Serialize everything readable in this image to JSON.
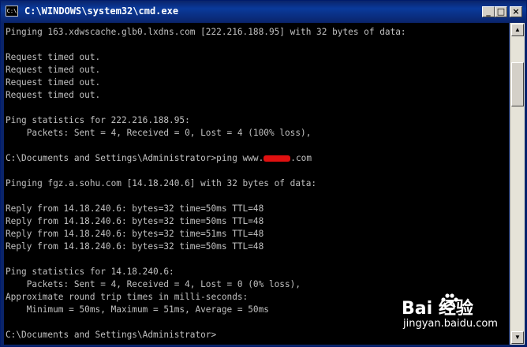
{
  "window": {
    "title": "C:\\WINDOWS\\system32\\cmd.exe",
    "icon_label": "C:\\"
  },
  "titlebar_buttons": {
    "minimize": "_",
    "maximize": "□",
    "close": "×"
  },
  "console": {
    "lines": [
      "Pinging 163.xdwscache.glb0.lxdns.com [222.216.188.95] with 32 bytes of data:",
      "",
      "Request timed out.",
      "Request timed out.",
      "Request timed out.",
      "Request timed out.",
      "",
      "Ping statistics for 222.216.188.95:",
      "    Packets: Sent = 4, Received = 0, Lost = 4 (100% loss),",
      "",
      "C:\\Documents and Settings\\Administrator>ping www.",
      "",
      "Pinging fgz.a.sohu.com [14.18.240.6] with 32 bytes of data:",
      "",
      "Reply from 14.18.240.6: bytes=32 time=50ms TTL=48",
      "Reply from 14.18.240.6: bytes=32 time=50ms TTL=48",
      "Reply from 14.18.240.6: bytes=32 time=51ms TTL=48",
      "Reply from 14.18.240.6: bytes=32 time=50ms TTL=48",
      "",
      "Ping statistics for 14.18.240.6:",
      "    Packets: Sent = 4, Received = 4, Lost = 0 (0% loss),",
      "Approximate round trip times in milli-seconds:",
      "    Minimum = 50ms, Maximum = 51ms, Average = 50ms",
      "",
      "C:\\Documents and Settings\\Administrator>"
    ],
    "redacted_suffix": ".com"
  },
  "scrollbar": {
    "up_arrow": "▲",
    "down_arrow": "▼"
  },
  "watermark": {
    "brand": "Bai  经验",
    "url": "jingyan.baidu.com"
  },
  "colors": {
    "console_bg": "#000000",
    "console_fg": "#c0c0c0",
    "titlebar": "#0a246a",
    "redaction": "#e01010"
  }
}
